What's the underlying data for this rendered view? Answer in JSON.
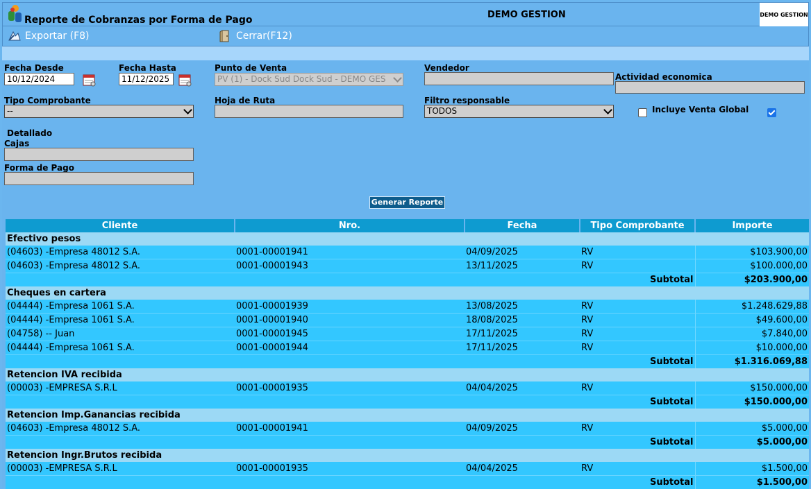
{
  "header": {
    "title": "Reporte de Cobranzas por Forma de Pago",
    "company": "DEMO GESTION",
    "logo_text": "DEMO GESTION"
  },
  "toolbar": {
    "export_label": "Exportar (F8)",
    "close_label": "Cerrar(F12)"
  },
  "filters": {
    "fecha_desde_label": "Fecha Desde",
    "fecha_desde_value": "10/12/2024",
    "fecha_hasta_label": "Fecha Hasta",
    "fecha_hasta_value": "11/12/2025",
    "punto_venta_label": "Punto de Venta",
    "punto_venta_value": "PV (1) - Dock Sud Dock Sud - DEMO GES",
    "vendedor_label": "Vendedor",
    "vendedor_value": "",
    "actividad_label": "Actividad economica",
    "actividad_value": "",
    "tipo_comprobante_label": "Tipo Comprobante",
    "tipo_comprobante_value": "--",
    "hoja_ruta_label": "Hoja de Ruta",
    "hoja_ruta_value": "",
    "filtro_responsable_label": "Filtro responsable",
    "filtro_responsable_value": "TODOS",
    "incluye_venta_global_label": "Incluye Venta Global",
    "incluye_venta_global_checked": false,
    "detallado_label": "Detallado",
    "detallado_checked": true,
    "cajas_label": "Cajas",
    "cajas_value": "",
    "forma_pago_label": "Forma de Pago",
    "forma_pago_value": "",
    "generate_label": "Generar Reporte"
  },
  "table": {
    "columns": [
      "Cliente",
      "Nro.",
      "Fecha",
      "Tipo Comprobante",
      "Importe"
    ],
    "subtotal_label": "Subtotal",
    "groups": [
      {
        "name": "Efectivo pesos",
        "rows": [
          [
            "(04603) -Empresa 48012 S.A.",
            "0001-00001941",
            "04/09/2025",
            "RV",
            "$103.900,00"
          ],
          [
            "(04603) -Empresa 48012 S.A.",
            "0001-00001943",
            "13/11/2025",
            "RV",
            "$100.000,00"
          ]
        ],
        "subtotal": "$203.900,00"
      },
      {
        "name": "Cheques en cartera",
        "rows": [
          [
            "(04444) -Empresa 1061 S.A.",
            "0001-00001939",
            "13/08/2025",
            "RV",
            "$1.248.629,88"
          ],
          [
            "(04444) -Empresa 1061 S.A.",
            "0001-00001940",
            "18/08/2025",
            "RV",
            "$49.600,00"
          ],
          [
            "(04758) -- Juan",
            "0001-00001945",
            "17/11/2025",
            "RV",
            "$7.840,00"
          ],
          [
            "(04444) -Empresa 1061 S.A.",
            "0001-00001944",
            "17/11/2025",
            "RV",
            "$10.000,00"
          ]
        ],
        "subtotal": "$1.316.069,88"
      },
      {
        "name": "Retencion IVA recibida",
        "rows": [
          [
            "(00003) -EMPRESA S.R.L",
            "0001-00001935",
            "04/04/2025",
            "RV",
            "$150.000,00"
          ]
        ],
        "subtotal": "$150.000,00"
      },
      {
        "name": "Retencion Imp.Ganancias recibida",
        "rows": [
          [
            "(04603) -Empresa 48012 S.A.",
            "0001-00001941",
            "04/09/2025",
            "RV",
            "$5.000,00"
          ]
        ],
        "subtotal": "$5.000,00"
      },
      {
        "name": "Retencion Ingr.Brutos recibida",
        "rows": [
          [
            "(00003) -EMPRESA S.R.L",
            "0001-00001935",
            "04/04/2025",
            "RV",
            "$1.500,00"
          ]
        ],
        "subtotal": "$1.500,00"
      }
    ]
  }
}
